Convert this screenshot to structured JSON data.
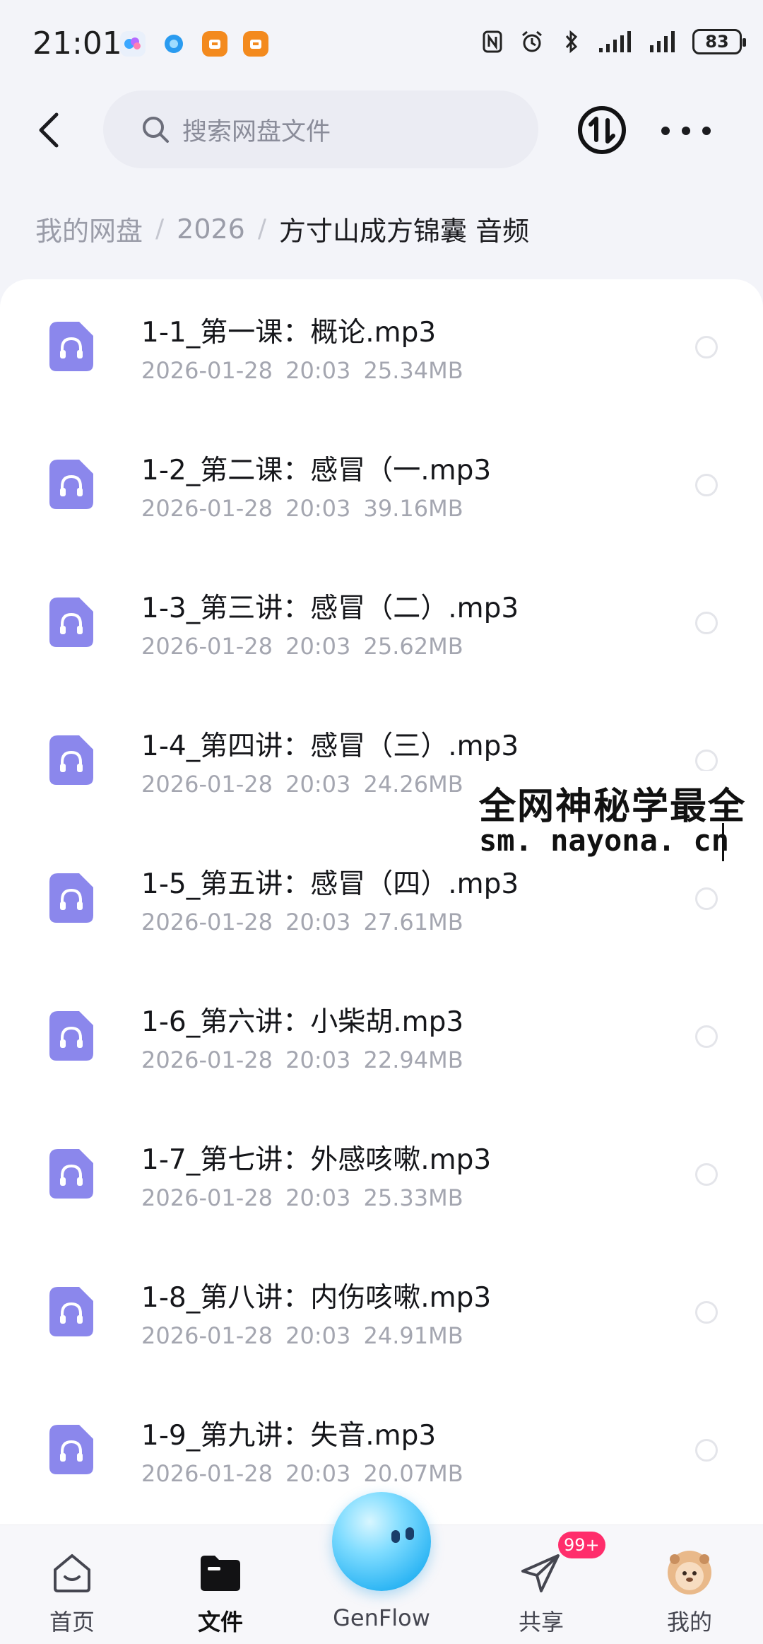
{
  "status_bar": {
    "time": "21:01",
    "battery": "83",
    "app_icons": [
      "genflow-app-icon",
      "browser-app-icon",
      "orange-app-icon",
      "orange-app-icon"
    ],
    "indicator_icons": [
      "nfc-icon",
      "alarm-icon",
      "bluetooth-icon",
      "signal-icon",
      "signal-icon"
    ]
  },
  "header": {
    "search_placeholder": "搜索网盘文件"
  },
  "breadcrumb": {
    "items": [
      "我的网盘",
      "2026",
      "方寸山成方锦囊 音频"
    ],
    "separator": "/"
  },
  "files": [
    {
      "name": "1-1_第一课：概论.mp3",
      "date": "2026-01-28",
      "time": "20:03",
      "size": "25.34MB"
    },
    {
      "name": "1-2_第二课：感冒（一.mp3",
      "date": "2026-01-28",
      "time": "20:03",
      "size": "39.16MB"
    },
    {
      "name": "1-3_第三讲：感冒（二）.mp3",
      "date": "2026-01-28",
      "time": "20:03",
      "size": "25.62MB"
    },
    {
      "name": "1-4_第四讲：感冒（三）.mp3",
      "date": "2026-01-28",
      "time": "20:03",
      "size": "24.26MB"
    },
    {
      "name": "1-5_第五讲：感冒（四）.mp3",
      "date": "2026-01-28",
      "time": "20:03",
      "size": "27.61MB"
    },
    {
      "name": "1-6_第六讲：小柴胡.mp3",
      "date": "2026-01-28",
      "time": "20:03",
      "size": "22.94MB"
    },
    {
      "name": "1-7_第七讲：外感咳嗽.mp3",
      "date": "2026-01-28",
      "time": "20:03",
      "size": "25.33MB"
    },
    {
      "name": "1-8_第八讲：内伤咳嗽.mp3",
      "date": "2026-01-28",
      "time": "20:03",
      "size": "24.91MB"
    },
    {
      "name": "1-9_第九讲：失音.mp3",
      "date": "2026-01-28",
      "time": "20:03",
      "size": "20.07MB"
    }
  ],
  "watermark": {
    "line1": "全网神秘学最全",
    "line2": "sm. nayona. cn"
  },
  "bottom_nav": {
    "items": [
      {
        "label": "首页",
        "icon": "home-icon",
        "active": false
      },
      {
        "label": "文件",
        "icon": "folder-icon",
        "active": true
      },
      {
        "label": "GenFlow",
        "icon": "genflow-orb-icon",
        "active": false
      },
      {
        "label": "共享",
        "icon": "paper-plane-icon",
        "active": false
      },
      {
        "label": "我的",
        "icon": "avatar-icon",
        "active": false
      }
    ],
    "share_badge": "99+"
  },
  "colors": {
    "accent": "#7a78e8",
    "file_icon": "#8b87ec",
    "badge": "#ff2d6b",
    "page_bg": "#f3f4f9"
  }
}
